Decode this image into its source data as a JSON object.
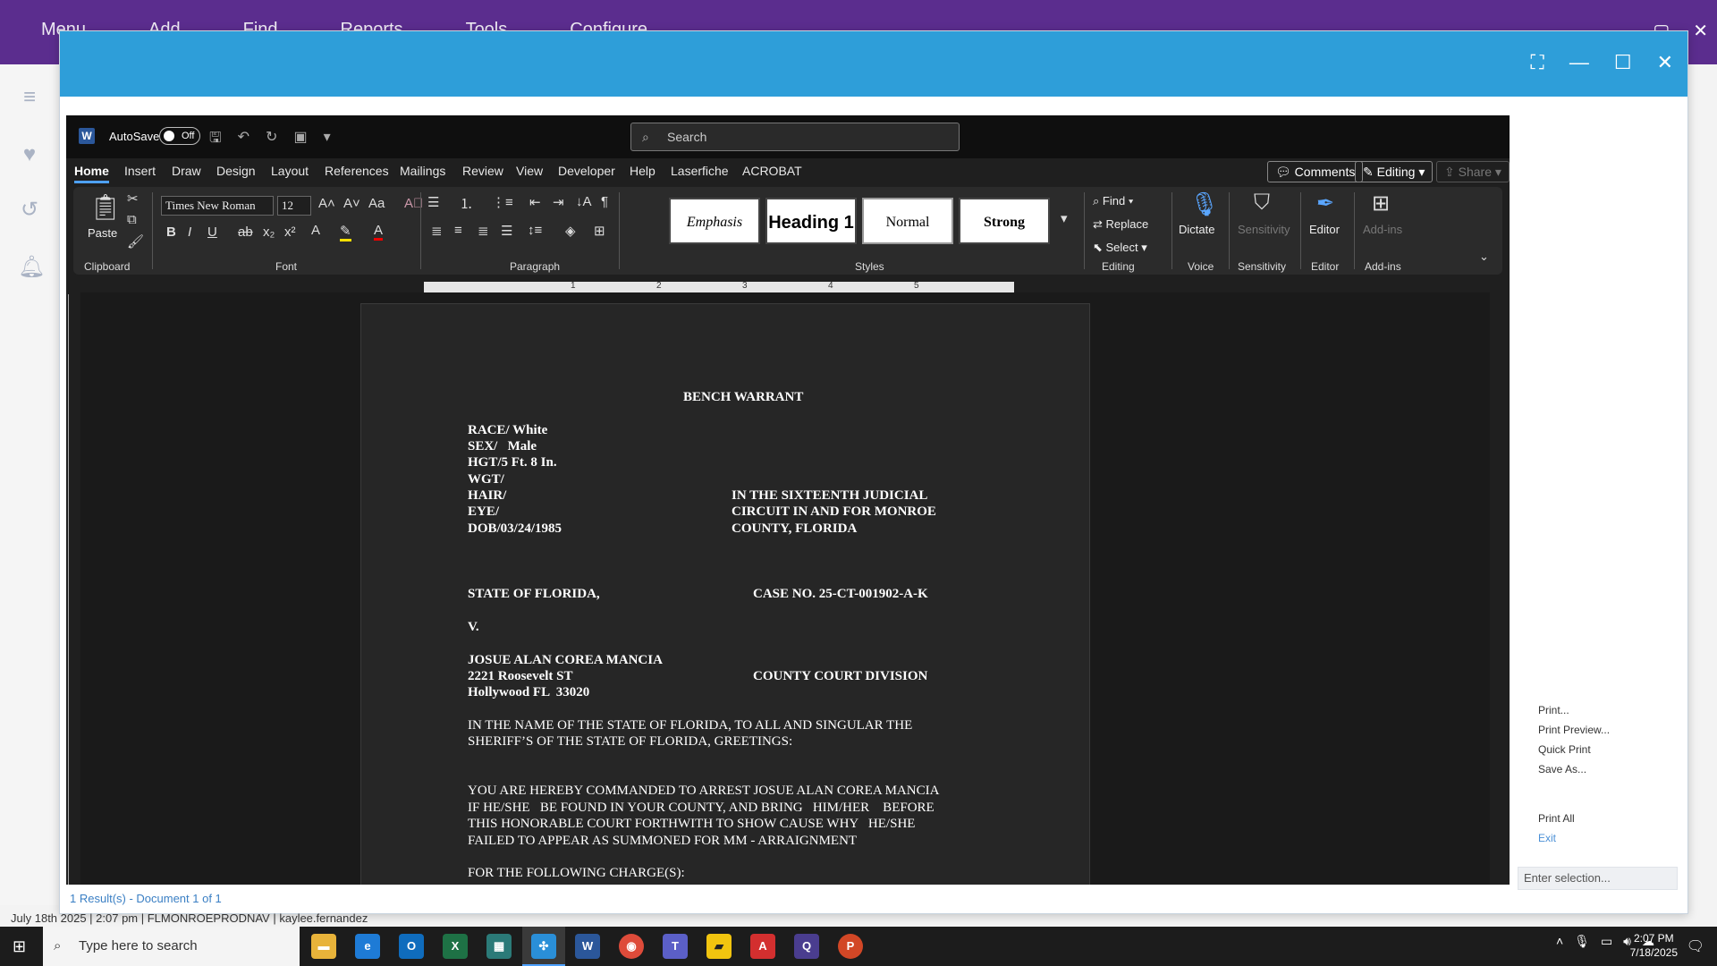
{
  "app": {
    "menu": [
      "Menu",
      "Add",
      "Find",
      "Reports",
      "Tools",
      "Configure"
    ]
  },
  "dialog": {
    "footer_result": "1 Result(s) - Document 1 of 1"
  },
  "status_bar": "July 18th 2025 | 2:07 pm | FLMONROEPRODNAV | kaylee.fernandez",
  "word": {
    "autosave_label": "AutoSave",
    "autosave_state": "Off",
    "search_placeholder": "Search",
    "tabs": [
      "Home",
      "Insert",
      "Draw",
      "Design",
      "Layout",
      "References",
      "Mailings",
      "Review",
      "View",
      "Developer",
      "Help",
      "Laserfiche",
      "ACROBAT"
    ],
    "comments_label": "Comments",
    "editing_label": "Editing",
    "share_label": "Share",
    "ribbon": {
      "paste_label": "Paste",
      "font_name": "Times New Roman",
      "font_size": "12",
      "styles": [
        "Emphasis",
        "Heading 1",
        "Normal",
        "Strong"
      ],
      "find_label": "Find",
      "replace_label": "Replace",
      "select_label": "Select",
      "dictate_label": "Dictate",
      "sensitivity_label": "Sensitivity",
      "editor_label": "Editor",
      "addins_label": "Add-ins",
      "groups": [
        "Clipboard",
        "Font",
        "Paragraph",
        "Styles",
        "Editing",
        "Voice",
        "Sensitivity",
        "Editor",
        "Add-ins"
      ]
    },
    "ruler_numbers": [
      "1",
      "2",
      "3",
      "4",
      "5"
    ],
    "document": {
      "title": "BENCH WARRANT",
      "race": "RACE/ White",
      "sex": "SEX/   Male",
      "hgt": "HGT/5 Ft. 8 In.",
      "wgt": "WGT/",
      "hair": "HAIR/",
      "eye": "EYE/",
      "dob": "DOB/03/24/1985",
      "court_1": "IN THE SIXTEENTH JUDICIAL",
      "court_2": "CIRCUIT IN AND FOR MONROE",
      "court_3": "COUNTY, FLORIDA",
      "state": "STATE OF FLORIDA,",
      "case_no": "CASE NO. 25-CT-001902-A-K",
      "versus": "V.",
      "defendant_name": "JOSUE ALAN COREA MANCIA",
      "address_1": "2221 Roosevelt ST",
      "address_2": "Hollywood FL  33020",
      "division": "COUNTY COURT DIVISION",
      "greeting_1": "IN THE NAME OF THE STATE OF FLORIDA, TO ALL AND SINGULAR THE",
      "greeting_2": "SHERIFF’S OF THE STATE OF FLORIDA, GREETINGS:",
      "command_1": "YOU ARE HEREBY COMMANDED TO ARREST JOSUE ALAN COREA MANCIA",
      "command_2": "IF HE/SHE   BE FOUND IN YOUR COUNTY, AND BRING   HIM/HER    BEFORE",
      "command_3": "THIS HONORABLE COURT FORTHWITH TO SHOW CAUSE WHY   HE/SHE",
      "command_4": "FAILED TO APPEAR AS SUMMONED FOR MM - ARRAIGNMENT",
      "charges": "FOR THE FOLLOWING CHARGE(S):"
    }
  },
  "print_menu": {
    "items": [
      "Print...",
      "Print Preview...",
      "Quick Print",
      "Save As...",
      "Print All",
      "Exit"
    ],
    "enter_selection_placeholder": "Enter selection..."
  },
  "taskbar": {
    "search_placeholder": "Type here to search",
    "time": "2:07 PM",
    "date": "7/18/2025"
  }
}
